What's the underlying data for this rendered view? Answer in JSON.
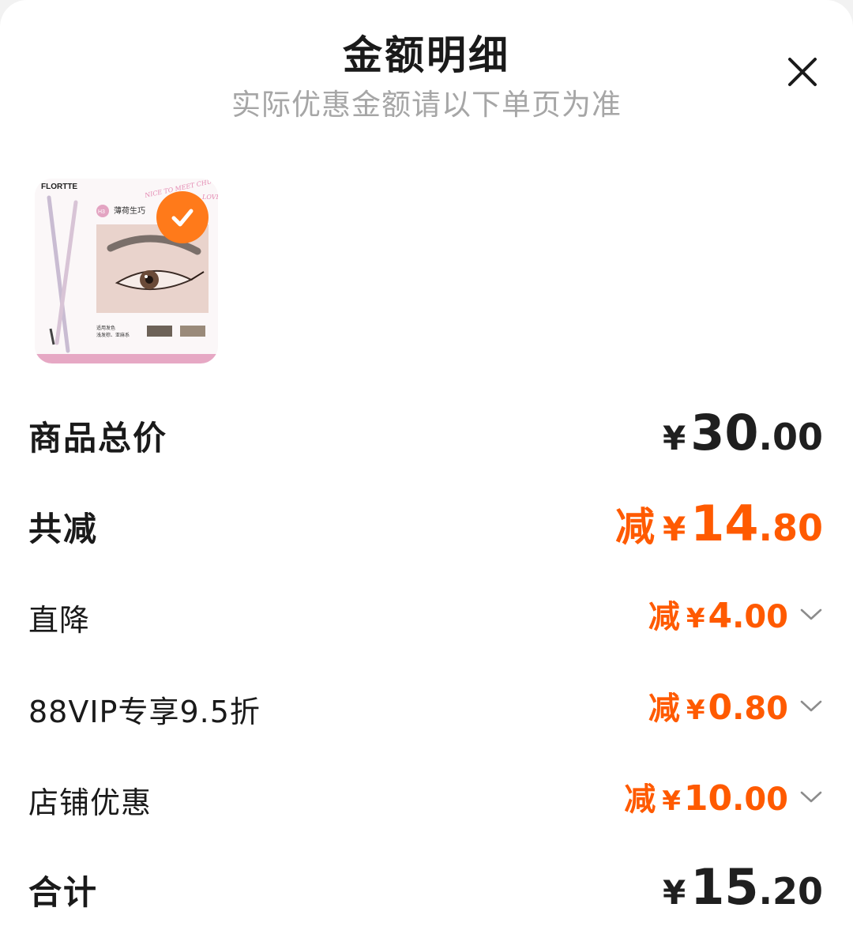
{
  "header": {
    "title": "金额明细",
    "subtitle": "实际优惠金额请以下单页为准",
    "close_icon": "close-icon"
  },
  "product": {
    "brand_text": "FLORTTE",
    "shade_code": "H3",
    "shade_name": "薄荷生巧",
    "script_text": "NICE TO MEET CHU",
    "script_text2": "LOVE",
    "caption_line1": "适用发色",
    "caption_line2": "浅发棕、亚麻系",
    "selected_icon": "check-icon"
  },
  "summary": {
    "total": {
      "label": "商品总价",
      "yen": "¥",
      "int": "30",
      "dec": ".00"
    },
    "discount_total": {
      "label": "共减",
      "prefix": "减",
      "yen": "¥",
      "int": "14",
      "dec": ".80"
    },
    "discounts": [
      {
        "label": "直降",
        "prefix": "减",
        "yen": "¥",
        "int": "4",
        "dec": ".00",
        "icon": "chevron-down-icon"
      },
      {
        "label": "88VIP专享9.5折",
        "prefix": "减",
        "yen": "¥",
        "int": "0",
        "dec": ".80",
        "icon": "chevron-down-icon"
      },
      {
        "label": "店铺优惠",
        "prefix": "减",
        "yen": "¥",
        "int": "10",
        "dec": ".00",
        "icon": "chevron-down-icon"
      }
    ],
    "final": {
      "label": "合计",
      "yen": "¥",
      "int": "15",
      "dec": ".20"
    }
  },
  "colors": {
    "accent_orange": "#ff5a00",
    "badge_orange": "#ff7a1a",
    "text_dark": "#1a1a1a",
    "text_gray": "#a6a6a6"
  }
}
